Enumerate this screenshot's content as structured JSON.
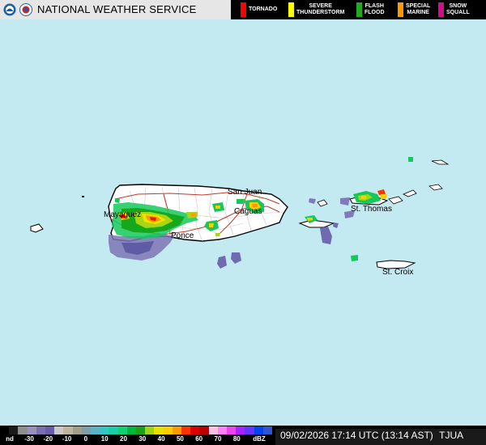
{
  "header": {
    "title": "NATIONAL WEATHER SERVICE"
  },
  "warning_legend": [
    {
      "label": "TORNADO",
      "color": "#ff0000"
    },
    {
      "label": "SEVERE\nTHUNDERSTORM",
      "color": "#ffff00"
    },
    {
      "label": "FLASH\nFLOOD",
      "color": "#22aa22"
    },
    {
      "label": "SPECIAL\nMARINE",
      "color": "#ff9900"
    },
    {
      "label": "SNOW\nSQUALL",
      "color": "#cc1188"
    }
  ],
  "map": {
    "place_labels": [
      "San Juan",
      "Caguas",
      "Mayaguez",
      "Ponce",
      "St. Thomas",
      "St. Croix"
    ],
    "colors": {
      "ocean": "#c4eaf1",
      "land": "#ffffff",
      "roads": "#c0392b",
      "boundaries": "#c8c8c8"
    }
  },
  "scale": {
    "nd_label": "nd",
    "ticks": [
      "-30",
      "-20",
      "-10",
      "0",
      "10",
      "20",
      "30",
      "40",
      "50",
      "60",
      "70",
      "80"
    ],
    "unit": "dBZ",
    "colors": [
      "#000000",
      "#1a1a1a",
      "#8e8e8e",
      "#9c8ebf",
      "#7b6fb0",
      "#6a5da8",
      "#c8c8c8",
      "#bfb59e",
      "#a39e8a",
      "#7e9ea8",
      "#5ab3c9",
      "#33c6c6",
      "#17d0a8",
      "#0ed26e",
      "#02b83b",
      "#1ca016",
      "#9ed414",
      "#e8e000",
      "#ffcc00",
      "#ff9900",
      "#ff3300",
      "#dd0000",
      "#bb0000",
      "#ffc0e0",
      "#ff80ff",
      "#ee44ee",
      "#aa22ff",
      "#6633ff",
      "#0044ee",
      "#3355cc"
    ]
  },
  "timestamp": "09/02/2026 17:14 UTC (13:14 AST)",
  "radar_id": "TJUA"
}
